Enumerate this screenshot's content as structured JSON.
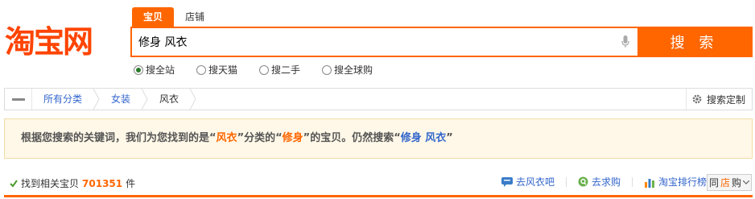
{
  "logo": {
    "text": "淘宝网"
  },
  "search": {
    "tabs": [
      {
        "label": "宝贝",
        "active": true
      },
      {
        "label": "店铺",
        "active": false
      }
    ],
    "query": "修身 风衣",
    "button_label": "搜 索",
    "mic_icon": "microphone-icon",
    "scopes": [
      {
        "label": "搜全站",
        "checked": true
      },
      {
        "label": "搜天猫",
        "checked": false
      },
      {
        "label": "搜二手",
        "checked": false
      },
      {
        "label": "搜全球购",
        "checked": false
      }
    ]
  },
  "breadcrumb": {
    "items": [
      {
        "label": "所有分类",
        "link": true
      },
      {
        "label": "女装",
        "link": true
      },
      {
        "label": "风衣",
        "link": false
      }
    ],
    "custom_label": "搜索定制",
    "custom_icon": "gear-icon"
  },
  "notice": {
    "prefix": "根据您搜索的关键词，我们为您找到的是“",
    "category": "风衣",
    "mid1": "”分类的“",
    "attribute": "修身",
    "mid2": "”的宝贝。仍然搜索“",
    "original_query": "修身 风衣",
    "suffix": "”"
  },
  "results": {
    "prefix": "找到相关宝贝",
    "count": "701351",
    "suffix": "件"
  },
  "links": [
    {
      "label": "去风衣吧",
      "icon": "chat-bubble-icon"
    },
    {
      "label": "去求购",
      "icon": "quote-icon"
    },
    {
      "label": "淘宝排行榜",
      "icon": "bar-chart-icon"
    }
  ],
  "same_store": {
    "prefix": "同",
    "store": "店",
    "suffix": "购"
  },
  "colors": {
    "accent": "#ff6600",
    "link": "#3366cc",
    "notice_bg": "#fff8e8"
  }
}
